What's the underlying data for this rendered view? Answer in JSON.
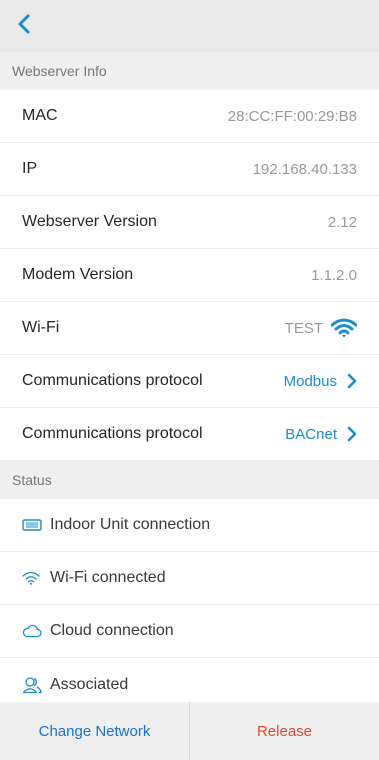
{
  "colors": {
    "accent": "#1a8fc9",
    "danger": "#e04a2c"
  },
  "webserver_info": {
    "header": "Webserver Info",
    "rows": [
      {
        "label": "MAC",
        "value": "28:CC:FF:00:29:B8"
      },
      {
        "label": "IP",
        "value": "192.168.40.133"
      },
      {
        "label": "Webserver Version",
        "value": "2.12"
      },
      {
        "label": "Modem Version",
        "value": "1.1.2.0"
      },
      {
        "label": "Wi-Fi",
        "value": "TEST"
      },
      {
        "label": "Communications protocol",
        "value": "Modbus"
      },
      {
        "label": "Communications protocol",
        "value": "BACnet"
      }
    ]
  },
  "status": {
    "header": "Status",
    "items": [
      {
        "label": "Indoor Unit connection",
        "icon": "indoor-unit-icon"
      },
      {
        "label": "Wi-Fi connected",
        "icon": "wifi-icon"
      },
      {
        "label": "Cloud connection",
        "icon": "cloud-icon"
      },
      {
        "label": "Associated",
        "icon": "users-icon"
      }
    ]
  },
  "footer": {
    "change_network": "Change Network",
    "release": "Release"
  }
}
